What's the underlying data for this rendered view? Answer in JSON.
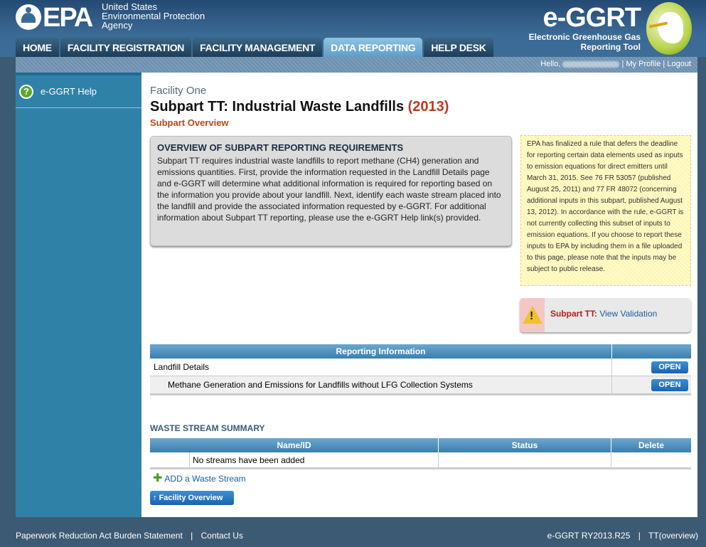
{
  "header": {
    "epa_logo_text": "EPA",
    "agency_line1": "United States",
    "agency_line2": "Environmental Protection",
    "agency_line3": "Agency",
    "brand_title": "e-GGRT",
    "brand_sub1": "Electronic Greenhouse Gas",
    "brand_sub2": "Reporting Tool"
  },
  "nav": {
    "tabs": [
      {
        "label": "HOME"
      },
      {
        "label": "FACILITY REGISTRATION"
      },
      {
        "label": "FACILITY MANAGEMENT"
      },
      {
        "label": "DATA REPORTING"
      },
      {
        "label": "HELP DESK"
      }
    ],
    "active_tab": "DATA REPORTING"
  },
  "userbar": {
    "hello": "Hello,",
    "my_profile": "My Profile",
    "logout": "Logout",
    "sep": "|"
  },
  "sidebar": {
    "help_label": "e-GGRT Help"
  },
  "page": {
    "facility_name": "Facility One",
    "title": "Subpart TT: Industrial Waste Landfills",
    "year": "(2013)",
    "subtitle": "Subpart Overview"
  },
  "overview": {
    "heading": "OVERVIEW OF SUBPART REPORTING REQUIREMENTS",
    "body": "Subpart TT requires industrial waste landfills to report methane (CH4) generation and emissions quantities. First, provide the information requested in the Landfill Details page and e-GGRT will determine what additional information is required for reporting based on the information you provide about your landfill. Next, identify each waste stream placed into the landfill and provide the associated information requested by e-GGRT. For additional information about Subpart TT reporting, please use the e-GGRT Help link(s) provided."
  },
  "notice": {
    "text": "EPA has finalized a rule that defers the deadline for reporting certain data elements used as inputs to emission equations for direct emitters until March 31, 2015. See 76 FR 53057 (published August 25, 2011) and 77 FR 48072 (concerning additional inputs in this subpart, published August 13, 2012). In accordance with the rule, e-GGRT is not currently collecting this subset of inputs to emission equations. If you choose to report these inputs to EPA by including them in a file uploaded to this page, please note that the inputs may be subject to public release."
  },
  "validation": {
    "label": "Subpart TT:",
    "link": "View Validation",
    "icon": "warning-icon"
  },
  "reporting_table": {
    "header": "Reporting Information",
    "rows": [
      {
        "label": "Landfill Details",
        "button": "OPEN"
      },
      {
        "label": "Methane Generation and Emissions for Landfills without LFG Collection Systems",
        "button": "OPEN"
      }
    ]
  },
  "waste_stream": {
    "title": "WASTE STREAM SUMMARY",
    "columns": [
      "Name/ID",
      "Status",
      "Delete"
    ],
    "empty_text": "No streams have been added",
    "add_link": "ADD a Waste Stream",
    "facility_overview_btn": "Facility Overview"
  },
  "footer": {
    "left1": "Paperwork Reduction Act Burden Statement",
    "left2": "Contact Us",
    "right1": "e-GGRT RY2013.R25",
    "right2": "TT(overview)",
    "sep": "|"
  },
  "colors": {
    "header_blue": "#3b6a95",
    "sidebar_blue": "#2f81a8",
    "title_red": "#c0391e",
    "link_blue": "#1a5da0"
  }
}
